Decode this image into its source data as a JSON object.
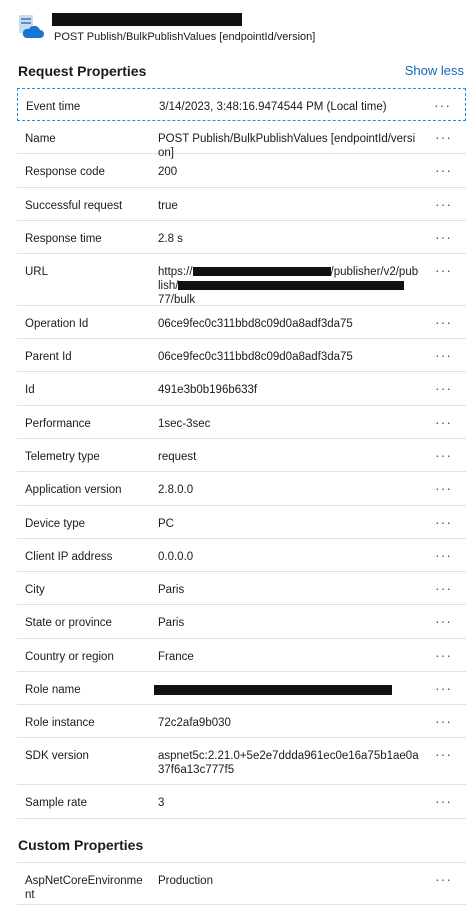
{
  "header": {
    "subtitle": "POST Publish/BulkPublishValues [endpointId/version]"
  },
  "request_section": {
    "title": "Request Properties",
    "toggle": "Show less",
    "rows": [
      {
        "label": "Event time",
        "value": "3/14/2023, 3:48:16.9474544 PM (Local time)"
      },
      {
        "label": "Name",
        "value": "POST Publish/BulkPublishValues [endpointId/version]"
      },
      {
        "label": "Response code",
        "value": "200"
      },
      {
        "label": "Successful request",
        "value": "true"
      },
      {
        "label": "Response time",
        "value": "2.8 s"
      },
      {
        "label": "URL",
        "value_line1": "https://",
        "value_line1b": "/publisher/v2/pub",
        "value_line2": "lish/",
        "value_line3": "77/bulk"
      },
      {
        "label": "Operation Id",
        "value": "06ce9fec0c311bbd8c09d0a8adf3da75"
      },
      {
        "label": "Parent Id",
        "value": "06ce9fec0c311bbd8c09d0a8adf3da75"
      },
      {
        "label": "Id",
        "value": "491e3b0b196b633f"
      },
      {
        "label": "Performance",
        "value": "1sec-3sec"
      },
      {
        "label": "Telemetry type",
        "value": "request"
      },
      {
        "label": "Application version",
        "value": "2.8.0.0"
      },
      {
        "label": "Device type",
        "value": "PC"
      },
      {
        "label": "Client IP address",
        "value": "0.0.0.0"
      },
      {
        "label": "City",
        "value": "Paris"
      },
      {
        "label": "State or province",
        "value": "Paris"
      },
      {
        "label": "Country or region",
        "value": "France"
      },
      {
        "label": "Role name",
        "value": ""
      },
      {
        "label": "Role instance",
        "value": "72c2afa9b030"
      },
      {
        "label": "SDK version",
        "value": "aspnet5c:2.21.0+5e2e7ddda961ec0e16a75b1ae0a37f6a13c777f5"
      },
      {
        "label": "Sample rate",
        "value": "3"
      }
    ]
  },
  "custom_section": {
    "title": "Custom Properties",
    "rows": [
      {
        "label": "AspNetCoreEnvironment",
        "value": "Production"
      }
    ]
  },
  "more_glyph": "···"
}
